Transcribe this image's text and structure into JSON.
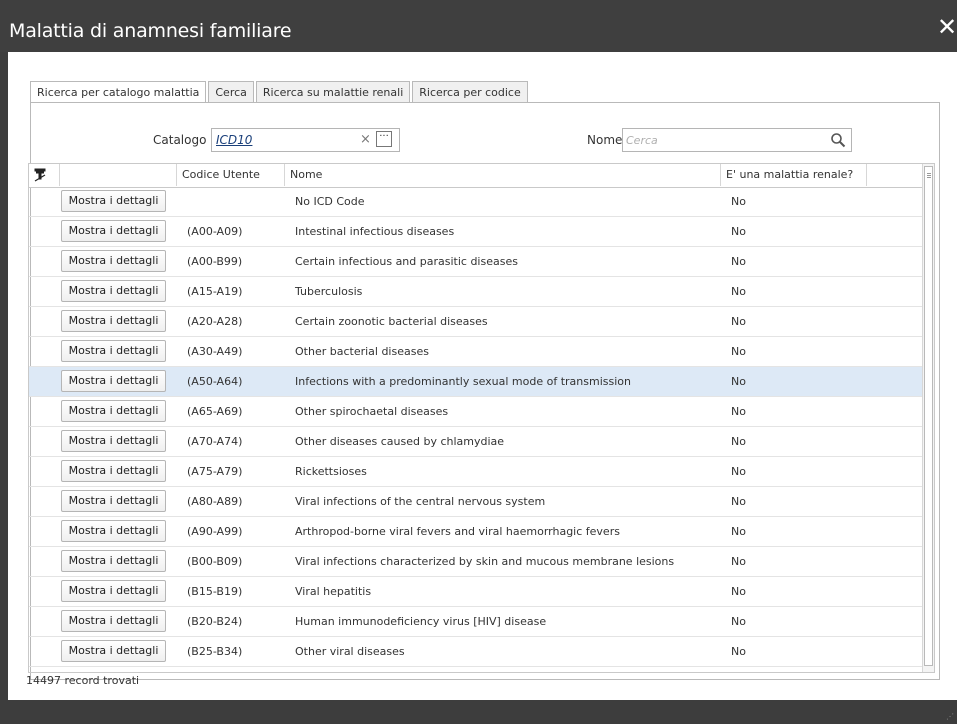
{
  "window": {
    "title": "Malattia di anamnesi familiare",
    "close_glyph": "✕"
  },
  "tabs": [
    {
      "label": "Ricerca per catalogo malattia",
      "active": true
    },
    {
      "label": "Cerca",
      "active": false
    },
    {
      "label": "Ricerca su malattie renali",
      "active": false
    },
    {
      "label": "Ricerca per codice",
      "active": false
    }
  ],
  "filters": {
    "catalog_label": "Catalogo",
    "catalog_value": "ICD10",
    "clear_glyph": "×",
    "ellipsis_glyph": "···",
    "name_label": "Nome",
    "name_placeholder": "Cerca",
    "name_value": ""
  },
  "grid": {
    "columns": [
      "",
      "Codice Utente",
      "Nome",
      "E' una malattia renale?"
    ],
    "button_label": "Mostra i dettagli",
    "rows": [
      {
        "code": "",
        "name": "No ICD Code",
        "renal": "No"
      },
      {
        "code": "(A00-A09)",
        "name": "Intestinal infectious diseases",
        "renal": "No"
      },
      {
        "code": "(A00-B99)",
        "name": "Certain infectious and parasitic diseases",
        "renal": "No"
      },
      {
        "code": "(A15-A19)",
        "name": "Tuberculosis",
        "renal": "No"
      },
      {
        "code": "(A20-A28)",
        "name": "Certain zoonotic bacterial diseases",
        "renal": "No"
      },
      {
        "code": "(A30-A49)",
        "name": "Other bacterial diseases",
        "renal": "No"
      },
      {
        "code": "(A50-A64)",
        "name": "Infections with a predominantly sexual mode of transmission",
        "renal": "No",
        "selected": true
      },
      {
        "code": "(A65-A69)",
        "name": "Other spirochaetal diseases",
        "renal": "No"
      },
      {
        "code": "(A70-A74)",
        "name": "Other diseases caused by chlamydiae",
        "renal": "No"
      },
      {
        "code": "(A75-A79)",
        "name": "Rickettsioses",
        "renal": "No"
      },
      {
        "code": "(A80-A89)",
        "name": "Viral infections of the central nervous system",
        "renal": "No"
      },
      {
        "code": "(A90-A99)",
        "name": "Arthropod-borne viral fevers and viral haemorrhagic fevers",
        "renal": "No"
      },
      {
        "code": "(B00-B09)",
        "name": "Viral infections characterized by skin and mucous membrane lesions",
        "renal": "No"
      },
      {
        "code": "(B15-B19)",
        "name": "Viral hepatitis",
        "renal": "No"
      },
      {
        "code": "(B20-B24)",
        "name": "Human immunodeficiency virus [HIV] disease",
        "renal": "No"
      },
      {
        "code": "(B25-B34)",
        "name": "Other viral diseases",
        "renal": "No"
      }
    ]
  },
  "footer": {
    "record_count": "14497 record trovati"
  },
  "colors": {
    "title_bar": "#3f3f3f",
    "selected_row": "#dde9f6",
    "link_value": "#1a3f7a"
  },
  "icons": [
    "close-icon",
    "clear-icon",
    "ellipsis-icon",
    "search-icon",
    "filter-icon",
    "resize-grip-icon"
  ]
}
